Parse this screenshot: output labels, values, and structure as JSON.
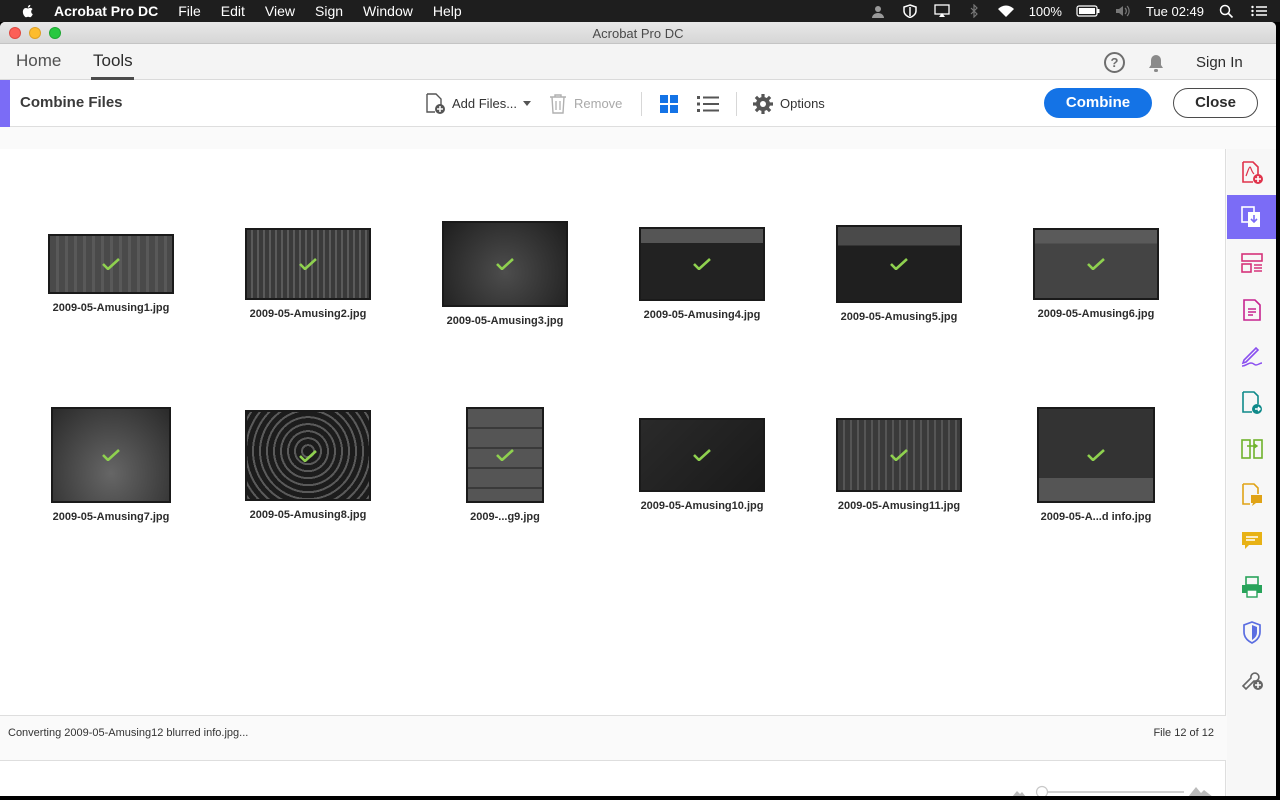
{
  "menubar": {
    "app_name": "Acrobat Pro DC",
    "items": [
      "File",
      "Edit",
      "View",
      "Sign",
      "Window",
      "Help"
    ],
    "battery": "100%",
    "clock": "Tue 02:49"
  },
  "window": {
    "title": "Acrobat Pro DC"
  },
  "nav": {
    "home": "Home",
    "tools": "Tools",
    "sign_in": "Sign In",
    "help": "?"
  },
  "toolbar": {
    "title": "Combine Files",
    "add_files": "Add Files...",
    "remove": "Remove",
    "options": "Options",
    "combine": "Combine",
    "close": "Close"
  },
  "files": [
    {
      "name": "2009-05-Amusing1.jpg"
    },
    {
      "name": "2009-05-Amusing2.jpg"
    },
    {
      "name": "2009-05-Amusing3.jpg"
    },
    {
      "name": "2009-05-Amusing4.jpg"
    },
    {
      "name": "2009-05-Amusing5.jpg"
    },
    {
      "name": "2009-05-Amusing6.jpg"
    },
    {
      "name": "2009-05-Amusing7.jpg"
    },
    {
      "name": "2009-05-Amusing8.jpg"
    },
    {
      "name": "2009-...g9.jpg"
    },
    {
      "name": "2009-05-Amusing10.jpg"
    },
    {
      "name": "2009-05-Amusing11.jpg"
    },
    {
      "name": "2009-05-A...d info.jpg"
    }
  ],
  "status": {
    "converting": "Converting 2009-05-Amusing12 blurred info.jpg...",
    "file_count": "File 12 of 12"
  },
  "colors": {
    "accent": "#1473e6",
    "rail_active": "#7b6cf6",
    "check": "#8fd14f"
  },
  "rail_icons": [
    "create-pdf-icon",
    "combine-files-icon",
    "organize-pages-icon",
    "export-pdf-icon",
    "fill-sign-icon",
    "send-for-review-icon",
    "edit-pdf-icon",
    "comment-icon",
    "comment-bubble-icon",
    "print-production-icon",
    "protect-icon",
    "more-tools-icon"
  ]
}
